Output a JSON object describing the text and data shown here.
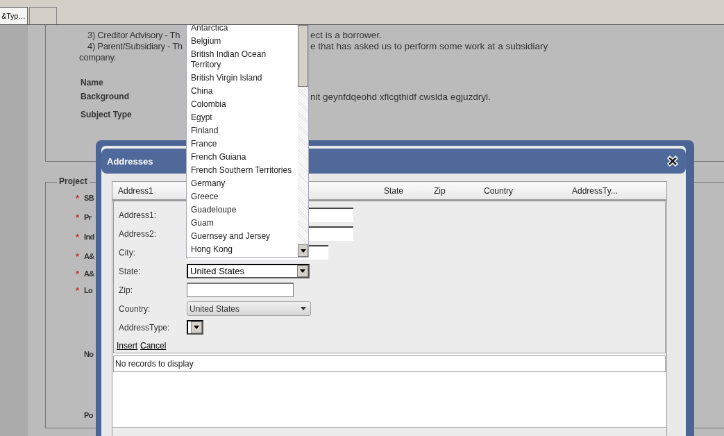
{
  "tabs": [
    {
      "label": "&Typ…",
      "selected": true
    },
    {
      "selected": false
    }
  ],
  "intro_lines": [
    {
      "kind": "item",
      "left": "3) Creditor Advisory - Th",
      "right": "ect is a borrower."
    },
    {
      "kind": "item",
      "left": "4) Parent/Subsidiary - Th",
      "right": "e that has asked us to perform some work at a subsidiary"
    },
    {
      "kind": "continuation",
      "left": "company."
    }
  ],
  "subject_fields": [
    {
      "label": "Name"
    },
    {
      "label": "Background",
      "value": "nit geynfdqeohd xflcgthidf cwslda egjuzdryl."
    },
    {
      "label": "Subject Type"
    }
  ],
  "project": {
    "legend": "Project",
    "fields": [
      {
        "label": "SB",
        "marker": "*"
      },
      {
        "label": "Pr",
        "marker": "*"
      },
      {
        "label": "Ind",
        "marker": "*"
      },
      {
        "label": "A&",
        "marker": "*"
      },
      {
        "label": "A&",
        "marker": "*"
      },
      {
        "label": "Lo",
        "marker": "*"
      },
      {
        "label": "No"
      },
      {
        "label": "Po"
      }
    ]
  },
  "addresses_dialog": {
    "title": "Addresses",
    "columns": [
      "Address1",
      "State",
      "Zip",
      "Country",
      "AddressTy..."
    ],
    "fields": [
      {
        "label": "Address1:",
        "kind": "text"
      },
      {
        "label": "Address2:",
        "kind": "text"
      },
      {
        "label": "City:",
        "kind": "text"
      },
      {
        "label": "State:",
        "kind": "select",
        "value": "United States"
      },
      {
        "label": "Zip:",
        "kind": "text"
      },
      {
        "label": "Country:",
        "kind": "combo",
        "value": "United States"
      },
      {
        "label": "AddressType:",
        "kind": "select"
      }
    ],
    "links": [
      "Insert",
      "Cancel"
    ],
    "empty_message": "No records to display"
  },
  "dropdown_list": {
    "items": [
      {
        "label": "Antarctica",
        "selected": false
      },
      {
        "label": "Belgium",
        "selected": false
      },
      {
        "label": "British Indian Ocean Territory",
        "selected": false
      },
      {
        "label": "British Virgin Island",
        "selected": false
      },
      {
        "label": "China",
        "selected": false
      },
      {
        "label": "Colombia",
        "selected": false
      },
      {
        "label": "Egypt",
        "selected": false
      },
      {
        "label": "Finland",
        "selected": false
      },
      {
        "label": "France",
        "selected": false
      },
      {
        "label": "French Guiana",
        "selected": false
      },
      {
        "label": "French Southern Territories",
        "selected": false
      },
      {
        "label": "Germany",
        "selected": false
      },
      {
        "label": "Greece",
        "selected": false
      },
      {
        "label": "Guadeloupe",
        "selected": false
      },
      {
        "label": "Guam",
        "selected": false
      },
      {
        "label": "Guernsey and Jersey",
        "selected": false
      },
      {
        "label": "Hong Kong",
        "selected": false
      }
    ]
  }
}
